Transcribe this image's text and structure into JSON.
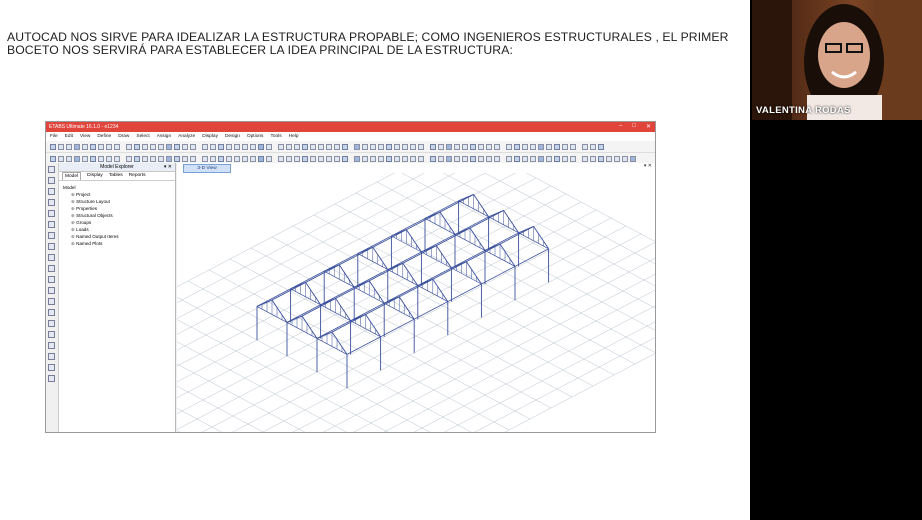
{
  "slide": {
    "text_line1": "AUTOCAD NOS SIRVE PARA IDEALIZAR LA ESTRUCTURA PROPABLE; COMO INGENIEROS ESTRUCTURALES , EL PRIMER",
    "text_line2": "BOCETO NOS SERVIRÁ PARA ESTABLECER LA IDEA PRINCIPAL DE LA ESTRUCTURA:"
  },
  "webcam": {
    "name": "VALENTINA RODAS"
  },
  "etabs": {
    "title": "ETABS Ultimate 16.1.0 - e1234",
    "menu": [
      "File",
      "Edit",
      "View",
      "Define",
      "Draw",
      "Select",
      "Assign",
      "Analyze",
      "Display",
      "Design",
      "Options",
      "Tools",
      "Help"
    ],
    "explorer": {
      "title": "Model Explorer",
      "tabs": [
        "Model",
        "Display",
        "Tables",
        "Reports"
      ],
      "root": "Model",
      "items": [
        "Project",
        "Structure Layout",
        "Properties",
        "Structural Objects",
        "Groups",
        "Loads",
        "Named Output Items",
        "Named Plots"
      ]
    },
    "view_tab": "3-D View"
  },
  "colors": {
    "titlebar": "#e0443a",
    "frame": "#3a4f9c",
    "grid": "#b9c3cf"
  }
}
